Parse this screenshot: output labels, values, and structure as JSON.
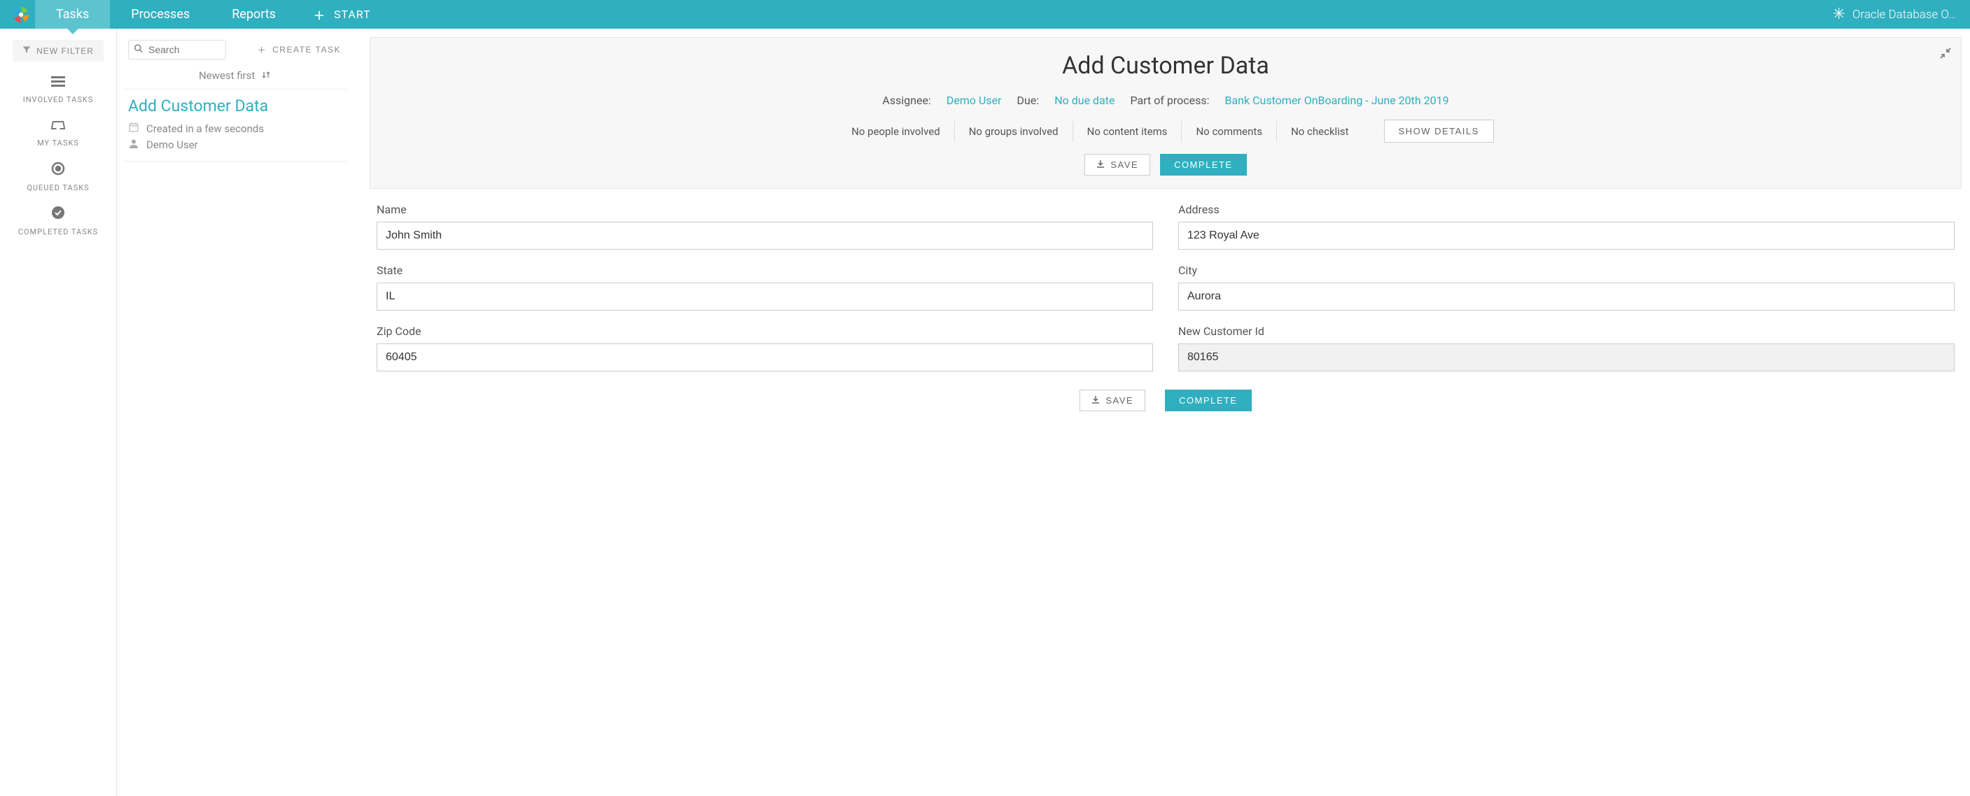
{
  "topnav": {
    "tabs": [
      {
        "label": "Tasks",
        "active": true
      },
      {
        "label": "Processes",
        "active": false
      },
      {
        "label": "Reports",
        "active": false
      }
    ],
    "start_label": "START",
    "right_label": "Oracle Database O…"
  },
  "sidebar": {
    "new_filter_label": "NEW FILTER",
    "items": [
      {
        "label": "INVOLVED TASKS",
        "icon": "bars"
      },
      {
        "label": "MY TASKS",
        "icon": "inbox"
      },
      {
        "label": "QUEUED TASKS",
        "icon": "target"
      },
      {
        "label": "COMPLETED TASKS",
        "icon": "check-circle"
      }
    ]
  },
  "tasklist": {
    "search_placeholder": "Search",
    "create_task_label": "CREATE TASK",
    "sort_label": "Newest first",
    "tasks": [
      {
        "title": "Add Customer Data",
        "created": "Created in a few seconds",
        "user": "Demo User"
      }
    ]
  },
  "detail": {
    "title": "Add Customer Data",
    "info": {
      "assignee_label": "Assignee:",
      "assignee": "Demo User",
      "due_label": "Due:",
      "due_value": "No due date",
      "process_label": "Part of process:",
      "process_value": "Bank Customer OnBoarding - June 20th 2019"
    },
    "chips": {
      "people": "No people involved",
      "groups": "No groups involved",
      "content": "No content items",
      "comments": "No comments",
      "checklist": "No checklist"
    },
    "show_details_label": "SHOW DETAILS",
    "save_label": "SAVE",
    "complete_label": "COMPLETE"
  },
  "form": {
    "fields": {
      "name": {
        "label": "Name",
        "value": "John Smith"
      },
      "address": {
        "label": "Address",
        "value": "123 Royal Ave"
      },
      "state": {
        "label": "State",
        "value": "IL"
      },
      "city": {
        "label": "City",
        "value": "Aurora"
      },
      "zip": {
        "label": "Zip Code",
        "value": "60405"
      },
      "customer_id": {
        "label": "New Customer Id",
        "value": "80165"
      }
    },
    "save_label": "SAVE",
    "complete_label": "COMPLETE"
  }
}
